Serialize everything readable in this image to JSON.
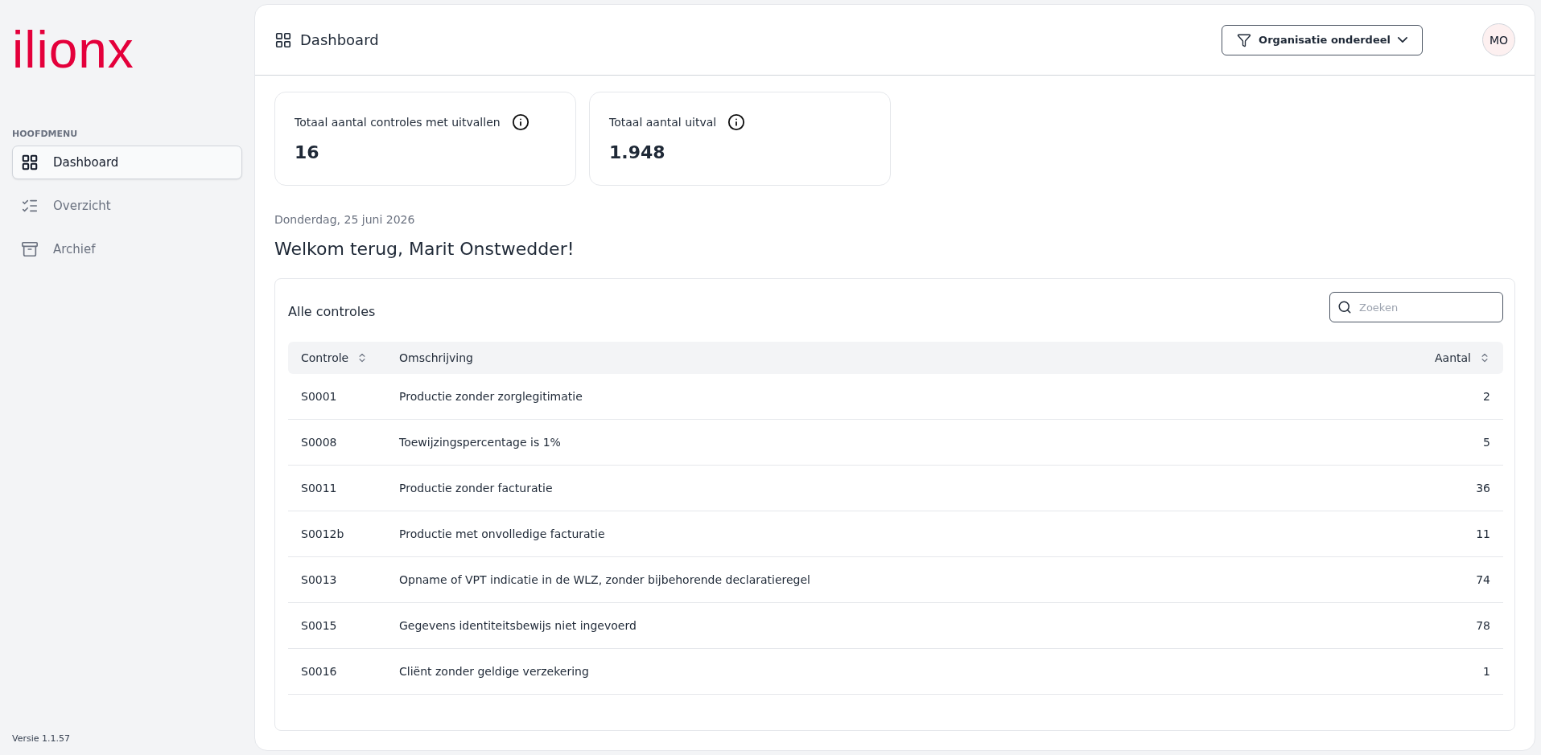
{
  "sidebar": {
    "logo": "ilionx",
    "section_label": "HOOFDMENU",
    "items": [
      {
        "label": "Dashboard",
        "selected": true
      },
      {
        "label": "Overzicht",
        "selected": false
      },
      {
        "label": "Archief",
        "selected": false
      }
    ],
    "version": "Versie 1.1.57"
  },
  "header": {
    "title": "Dashboard",
    "filter_button": "Organisatie onderdeel",
    "avatar": "MO"
  },
  "stat_cards": [
    {
      "label": "Totaal aantal controles met uitvallen",
      "value": "16"
    },
    {
      "label": "Totaal aantal uitval",
      "value": "1.948"
    }
  ],
  "date": "Donderdag, 25 juni 2026",
  "greeting": "Welkom terug, Marit Onstwedder!",
  "table": {
    "title": "Alle controles",
    "search": {
      "placeholder": "Zoeken"
    },
    "columns": [
      {
        "label": "Controle",
        "sortable": true
      },
      {
        "label": "Omschrijving",
        "sortable": false
      },
      {
        "label": "Aantal",
        "sortable": true
      }
    ],
    "rows": [
      [
        "S0001",
        "Productie zonder zorglegitimatie",
        "2"
      ],
      [
        "S0008",
        "Toewijzingspercentage is 1%",
        "5"
      ],
      [
        "S0011",
        "Productie zonder facturatie",
        "36"
      ],
      [
        "S0012b",
        "Productie met onvolledige facturatie",
        "11"
      ],
      [
        "S0013",
        "Opname of VPT indicatie in de WLZ, zonder bijbehorende declaratieregel",
        "74"
      ],
      [
        "S0015",
        "Gegevens identiteitsbewijs niet ingevoerd",
        "78"
      ],
      [
        "S0016",
        "Cliënt zonder geldige verzekering",
        "1"
      ]
    ]
  }
}
